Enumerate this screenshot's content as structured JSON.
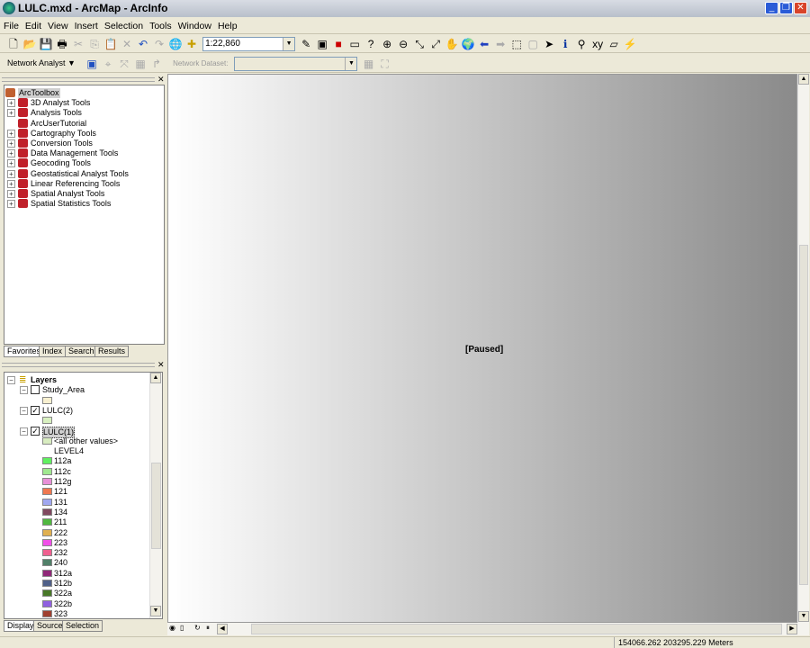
{
  "window": {
    "title": "LULC.mxd - ArcMap - ArcInfo",
    "min": "_",
    "max": "❐",
    "close": "✕"
  },
  "menu": [
    "File",
    "Edit",
    "View",
    "Insert",
    "Selection",
    "Tools",
    "Window",
    "Help"
  ],
  "toolbar": {
    "scale": "1:22,860"
  },
  "network_toolbar": {
    "label": "Network Analyst ▼",
    "dataset_label": "Network Dataset:",
    "dataset_value": ""
  },
  "toolbox": {
    "root": "ArcToolbox",
    "items": [
      {
        "label": "3D Analyst Tools",
        "expandable": true
      },
      {
        "label": "Analysis Tools",
        "expandable": true
      },
      {
        "label": "ArcUserTutorial",
        "expandable": false
      },
      {
        "label": "Cartography Tools",
        "expandable": true
      },
      {
        "label": "Conversion Tools",
        "expandable": true
      },
      {
        "label": "Data Management Tools",
        "expandable": true
      },
      {
        "label": "Geocoding Tools",
        "expandable": true
      },
      {
        "label": "Geostatistical Analyst Tools",
        "expandable": true
      },
      {
        "label": "Linear Referencing Tools",
        "expandable": true
      },
      {
        "label": "Spatial Analyst Tools",
        "expandable": true
      },
      {
        "label": "Spatial Statistics Tools",
        "expandable": true
      }
    ],
    "tabs": [
      "Favorites",
      "Index",
      "Search",
      "Results"
    ]
  },
  "toc": {
    "root": "Layers",
    "layers": [
      {
        "name": "Study_Area",
        "checked": false,
        "swatch": "#f8f0d0"
      },
      {
        "name": "LULC(2)",
        "checked": true,
        "swatch": "#d8f0c0"
      },
      {
        "name": "LULC(1)",
        "checked": true,
        "selected": true
      }
    ],
    "other_values": {
      "label": "<all other values>",
      "color": "#d8ecc0"
    },
    "field": "LEVEL4",
    "classes": [
      {
        "label": "112a",
        "color": "#60f060"
      },
      {
        "label": "112c",
        "color": "#a0e890"
      },
      {
        "label": "112g",
        "color": "#e890d8"
      },
      {
        "label": "121",
        "color": "#f07850"
      },
      {
        "label": "131",
        "color": "#a0a8f0"
      },
      {
        "label": "134",
        "color": "#804860"
      },
      {
        "label": "211",
        "color": "#50b840"
      },
      {
        "label": "222",
        "color": "#e0b050"
      },
      {
        "label": "223",
        "color": "#f050e8"
      },
      {
        "label": "232",
        "color": "#f06090"
      },
      {
        "label": "240",
        "color": "#508068"
      },
      {
        "label": "312a",
        "color": "#902878"
      },
      {
        "label": "312b",
        "color": "#506088"
      },
      {
        "label": "322a",
        "color": "#487828"
      },
      {
        "label": "322b",
        "color": "#9060e0"
      },
      {
        "label": "323",
        "color": "#a04030"
      }
    ],
    "tabs": [
      "Display",
      "Source",
      "Selection"
    ]
  },
  "map": {
    "status": "[Paused]"
  },
  "statusbar": {
    "coords": "154066.262  203295.229 Meters"
  }
}
